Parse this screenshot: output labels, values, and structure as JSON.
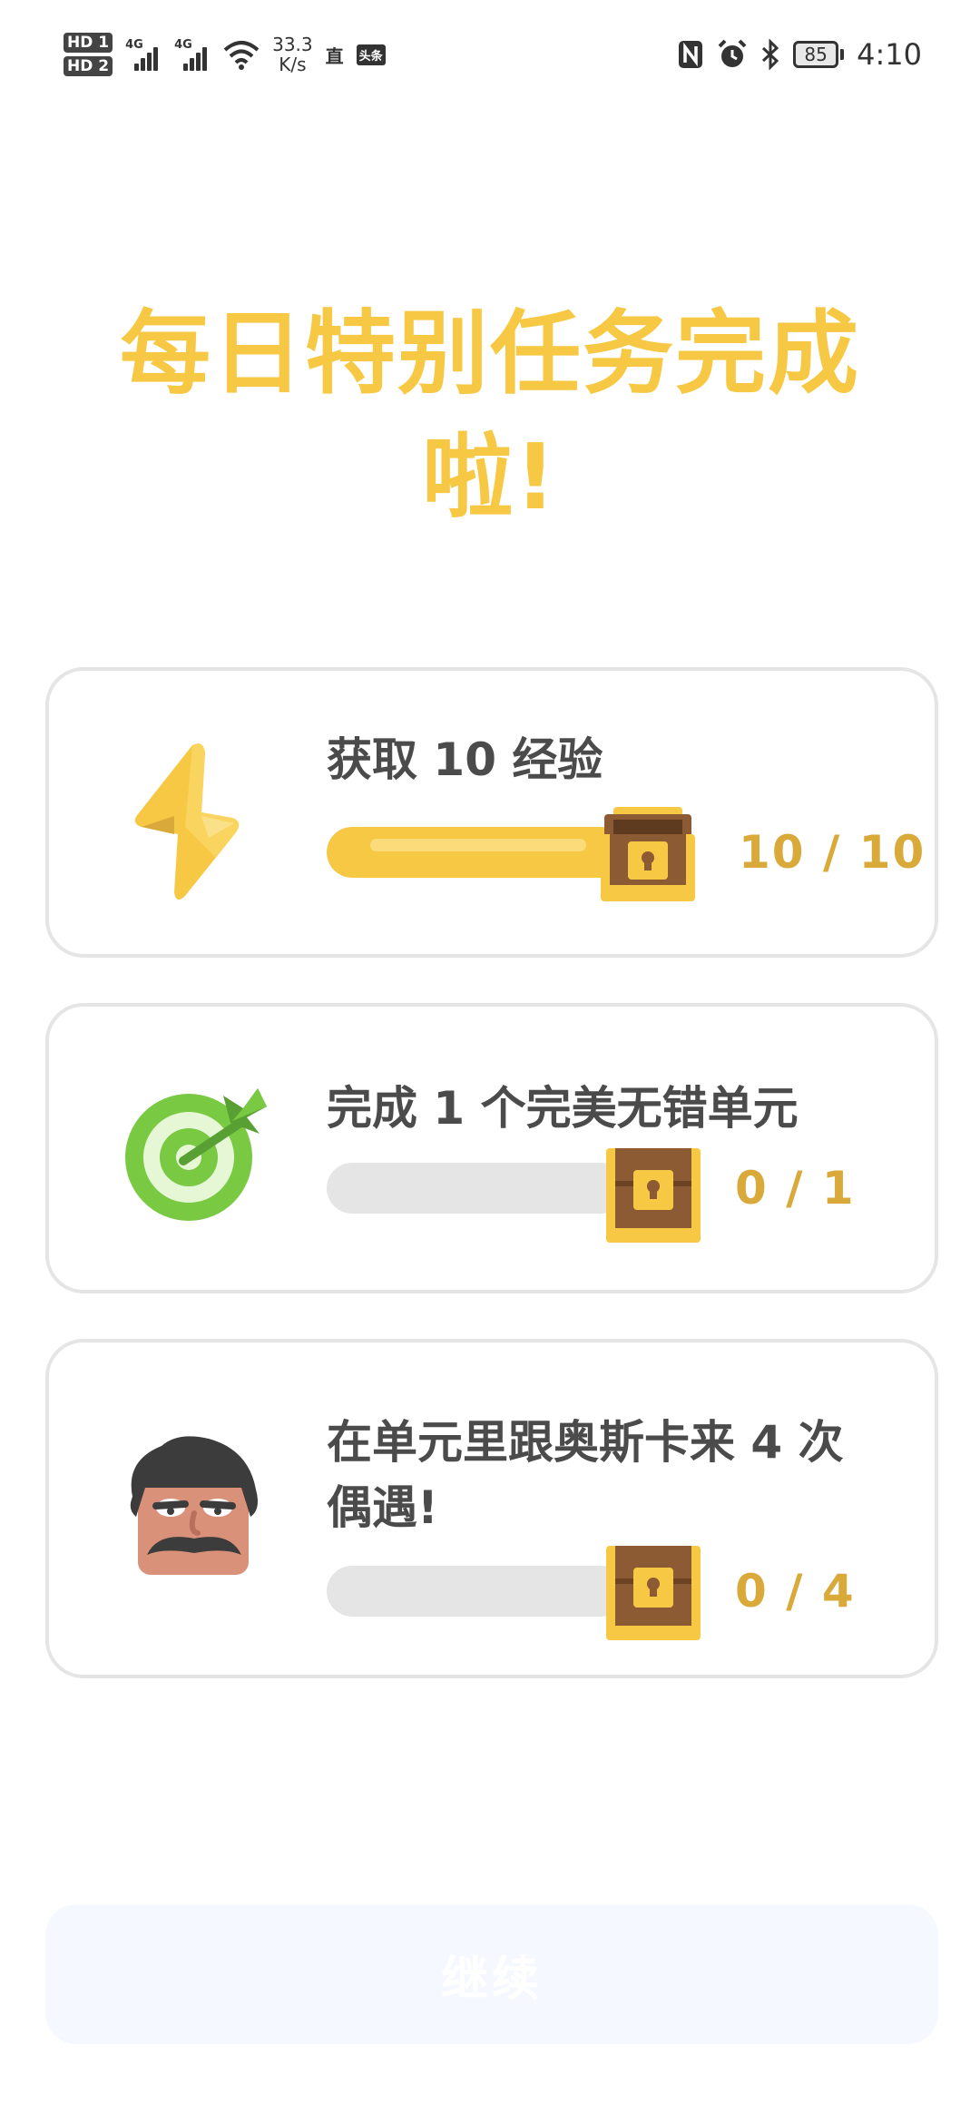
{
  "status_bar": {
    "hd1": "HD 1",
    "hd2": "HD 2",
    "sim1": "4G",
    "sim2": "4G",
    "net_speed_value": "33.3",
    "net_speed_unit": "K/s",
    "badge_zhi": "直",
    "app_icon_text": "头条",
    "battery": "85",
    "time": "4:10",
    "icons": [
      "signal-icon",
      "wifi-icon",
      "nfc-icon",
      "alarm-icon",
      "bluetooth-icon",
      "battery-icon"
    ]
  },
  "title": "每日特别任务完成啦!",
  "colors": {
    "accent_yellow": "#F7C843",
    "progress_text": "#D9A93A",
    "card_border": "#e5e5e5",
    "label_text": "#4b4b4b"
  },
  "quests": [
    {
      "icon": "lightning-icon",
      "label": "获取 10 经验",
      "progress_text": "10 / 10",
      "progress": 1.0,
      "chest_state": "open"
    },
    {
      "icon": "target-icon",
      "label": "完成 1 个完美无错单元",
      "progress_text": "0 / 1",
      "progress": 0.0,
      "chest_state": "closed"
    },
    {
      "icon": "oscar-avatar-icon",
      "label": "在单元里跟奥斯卡来 4 次偶遇!",
      "progress_text": "0 / 4",
      "progress": 0.0,
      "chest_state": "closed"
    }
  ],
  "continue_button": "继续"
}
